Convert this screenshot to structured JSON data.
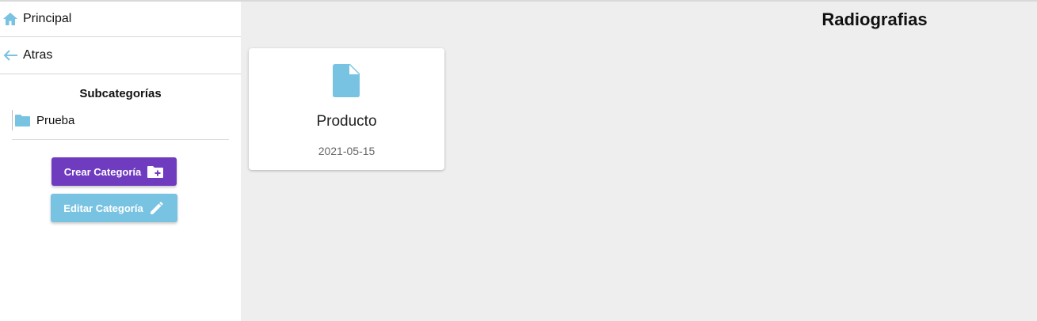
{
  "sidebar": {
    "nav": [
      {
        "label": "Principal",
        "icon": "home-icon"
      },
      {
        "label": "Atras",
        "icon": "arrow-left-icon"
      }
    ],
    "subcategories_title": "Subcategorías",
    "subcategories": [
      {
        "label": "Prueba",
        "icon": "folder-icon"
      }
    ],
    "create_button": "Crear Categoría",
    "edit_button": "Editar Categoría"
  },
  "main": {
    "title": "Radiografias",
    "cards": [
      {
        "title": "Producto",
        "date": "2021-05-15",
        "icon": "file-icon"
      }
    ]
  },
  "colors": {
    "accent_blue": "#79c3e2",
    "purple": "#6f3bbf",
    "background": "#eeeeee"
  }
}
